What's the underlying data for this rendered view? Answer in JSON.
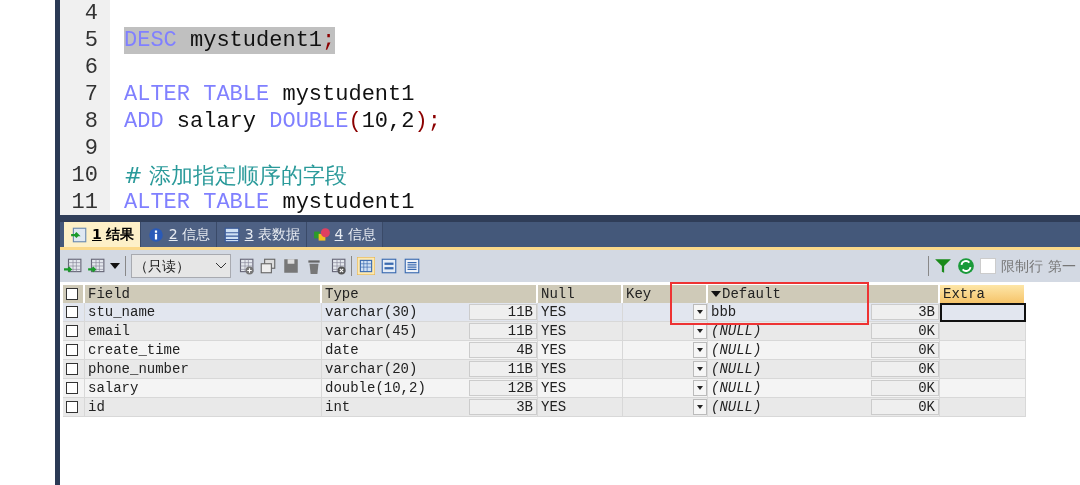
{
  "editor": {
    "lines": [
      {
        "number": "4"
      },
      {
        "number": "5",
        "highlighted": true,
        "tokens": [
          {
            "text": "DESC",
            "kind": "keyword"
          },
          {
            "text": " mystudent1",
            "kind": "plain"
          },
          {
            "text": ";",
            "kind": "punct"
          }
        ]
      },
      {
        "number": "6"
      },
      {
        "number": "7",
        "tokens": [
          {
            "text": "ALTER",
            "kind": "keyword"
          },
          {
            "text": " TABLE",
            "kind": "keyword"
          },
          {
            "text": " mystudent1",
            "kind": "plain"
          }
        ]
      },
      {
        "number": "8",
        "tokens": [
          {
            "text": "ADD",
            "kind": "keyword"
          },
          {
            "text": " salary ",
            "kind": "plain"
          },
          {
            "text": "DOUBLE",
            "kind": "keyword"
          },
          {
            "text": "(",
            "kind": "punct"
          },
          {
            "text": "10,2",
            "kind": "plain"
          },
          {
            "text": ");",
            "kind": "punct"
          }
        ]
      },
      {
        "number": "9"
      },
      {
        "number": "10",
        "tokens": [
          {
            "text": "# 添加指定顺序的字段",
            "kind": "comment"
          }
        ]
      },
      {
        "number": "11",
        "tokens": [
          {
            "text": "ALTER",
            "kind": "keyword"
          },
          {
            "text": " TABLE",
            "kind": "keyword"
          },
          {
            "text": " mystudent1",
            "kind": "plain"
          }
        ]
      }
    ]
  },
  "tabs": [
    {
      "number": "1",
      "label": "结果",
      "kind": "result",
      "selected": true
    },
    {
      "number": "2",
      "label": "信息",
      "kind": "info",
      "selected": false
    },
    {
      "number": "3",
      "label": "表数据",
      "kind": "table",
      "selected": false
    },
    {
      "number": "4",
      "label": "信息",
      "kind": "profile",
      "selected": false
    }
  ],
  "toolbar": {
    "mode": "（只读）",
    "limit_checked": false,
    "limit_label": "限制行",
    "first_label": "第一"
  },
  "grid": {
    "select_all_checked": false,
    "columns": [
      "Field",
      "Type",
      "Null",
      "Key",
      "Default",
      "Extra"
    ],
    "rows": [
      {
        "selected": true,
        "checked": false,
        "field": "stu_name",
        "type": "varchar(30)",
        "type_size": "11B",
        "null": "YES",
        "default": "bbb",
        "is_null": false,
        "default_size": "3B"
      },
      {
        "selected": false,
        "checked": false,
        "field": "email",
        "type": "varchar(45)",
        "type_size": "11B",
        "null": "YES",
        "default": "(NULL)",
        "is_null": true,
        "default_size": "0K"
      },
      {
        "selected": false,
        "checked": false,
        "field": "create_time",
        "type": "date",
        "type_size": "4B",
        "null": "YES",
        "default": "(NULL)",
        "is_null": true,
        "default_size": "0K"
      },
      {
        "selected": false,
        "checked": false,
        "field": "phone_number",
        "type": "varchar(20)",
        "type_size": "11B",
        "null": "YES",
        "default": "(NULL)",
        "is_null": true,
        "default_size": "0K"
      },
      {
        "selected": false,
        "checked": false,
        "field": "salary",
        "type": "double(10,2)",
        "type_size": "12B",
        "null": "YES",
        "default": "(NULL)",
        "is_null": true,
        "default_size": "0K"
      },
      {
        "selected": false,
        "checked": false,
        "field": "id",
        "type": "int",
        "type_size": "3B",
        "null": "YES",
        "default": "(NULL)",
        "is_null": true,
        "default_size": "0K"
      }
    ]
  }
}
